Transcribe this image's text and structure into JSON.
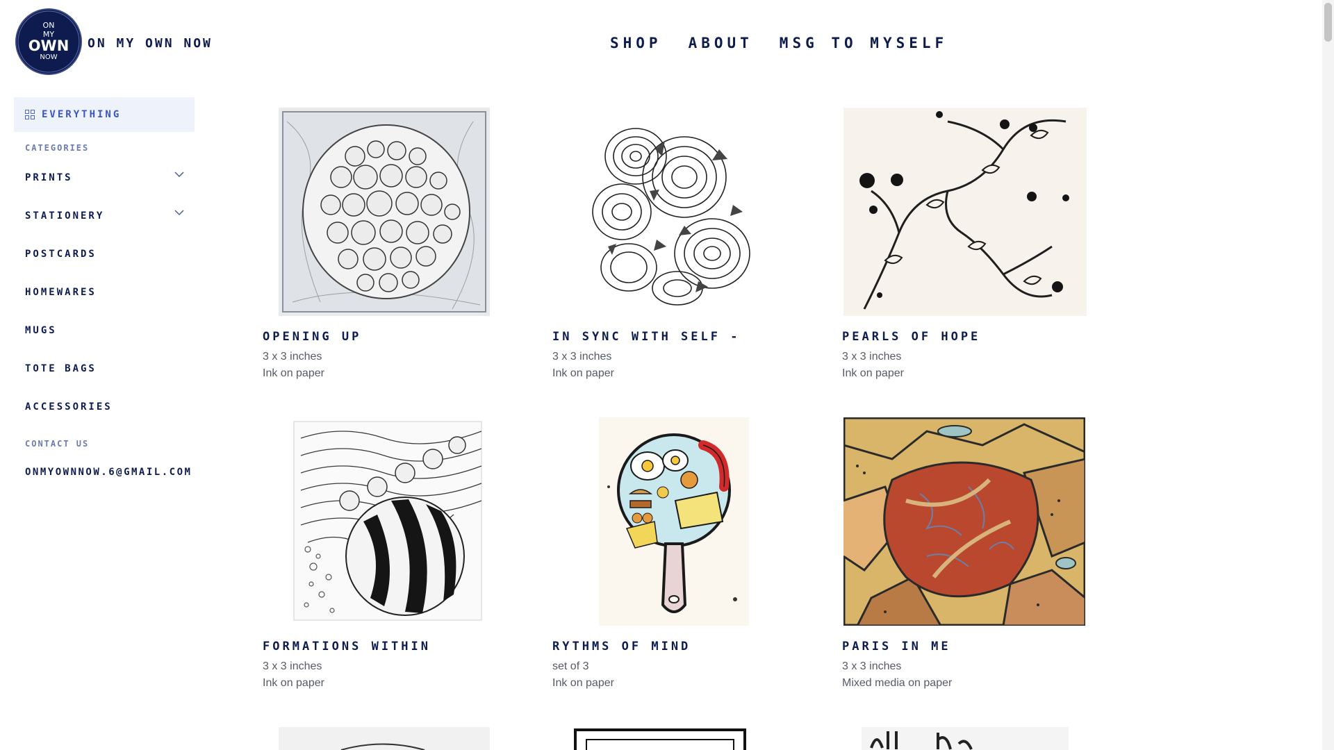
{
  "brand": {
    "name": "on my own now",
    "logo_text": [
      "ON",
      "MY",
      "OWN",
      "NOW"
    ]
  },
  "nav": {
    "items": [
      "SHOP",
      "ABOUT",
      "MSG TO MYSELF"
    ]
  },
  "sidebar": {
    "all_label": "EVERYTHING",
    "categories_label": "CATEGORIES",
    "categories": [
      {
        "label": "PRINTS",
        "expandable": true
      },
      {
        "label": "STATIONERY",
        "expandable": true
      },
      {
        "label": "POSTCARDS",
        "expandable": false
      },
      {
        "label": "HOMEWARES",
        "expandable": false
      },
      {
        "label": "MUGS",
        "expandable": false
      },
      {
        "label": "TOTE BAGS",
        "expandable": false
      },
      {
        "label": "ACCESSORIES",
        "expandable": false
      }
    ],
    "contact_label": "CONTACT US",
    "email": "onmyownnow.6@gmail.com"
  },
  "products": [
    {
      "title": "OPENING UP",
      "size": "3 x 3 inches",
      "medium": "Ink on paper",
      "image": "circles-zentangle-art"
    },
    {
      "title": "IN SYNC WITH SELF -",
      "size": "3 x 3 inches",
      "medium": "Ink on paper",
      "image": "swirl-rosettes-art"
    },
    {
      "title": "PEARLS OF HOPE",
      "size": "3 x 3 inches",
      "medium": "Ink on paper",
      "image": "vine-pearls-art"
    },
    {
      "title": "FORMATIONS WITHIN",
      "size": "3 x 3 inches",
      "medium": "Ink on paper",
      "image": "striped-sphere-art"
    },
    {
      "title": "RYTHMS OF MIND",
      "size": "set of 3",
      "medium": "Ink on paper",
      "image": "breakfast-pan-art"
    },
    {
      "title": "PARIS IN ME",
      "size": "3 x 3 inches",
      "medium": "Mixed media on paper",
      "image": "mosaic-color-art"
    }
  ],
  "colors": {
    "ink": "#0d1b4f",
    "accent": "#3a55c4",
    "selected_bg": "#eef2fb",
    "muted": "#6c7ab0"
  }
}
